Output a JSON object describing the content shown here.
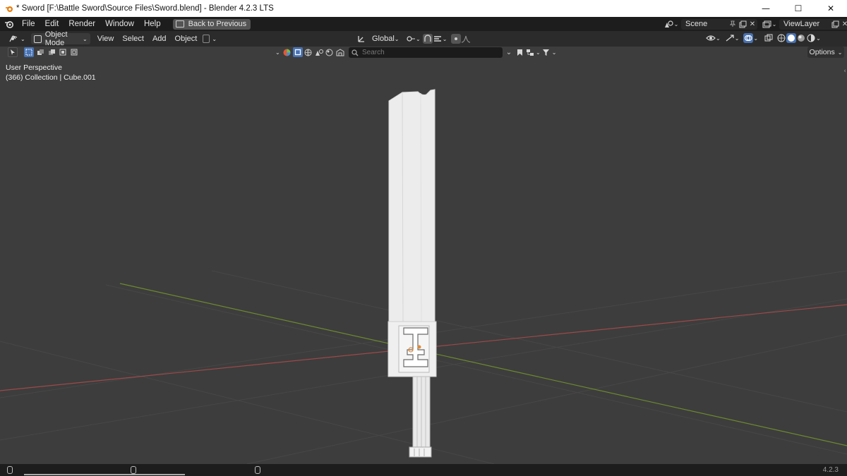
{
  "window": {
    "title": "* Sword [F:\\Battle Sword\\Source Files\\Sword.blend] - Blender 4.2.3 LTS",
    "controls": {
      "minimize": "—",
      "maximize": "☐",
      "close": "✕"
    }
  },
  "topbar": {
    "menus": [
      "File",
      "Edit",
      "Render",
      "Window",
      "Help"
    ],
    "back_button": "Back to Previous",
    "scene": "Scene",
    "view_layer": "ViewLayer"
  },
  "viewport_header": {
    "mode": "Object Mode",
    "menus": [
      "View",
      "Select",
      "Add",
      "Object"
    ],
    "orientation": "Global"
  },
  "tool_row": {
    "search_placeholder": "Search",
    "options": "Options"
  },
  "viewport": {
    "perspective": "User Perspective",
    "collection_info": "(366) Collection | Cube.001"
  },
  "statusbar": {
    "version": "4.2.3"
  },
  "colors": {
    "viewport_bg": "#3d3d3d",
    "x_axis": "#a04a4a",
    "y_axis": "#6d8a2e",
    "accent_blue": "#4772b3"
  }
}
